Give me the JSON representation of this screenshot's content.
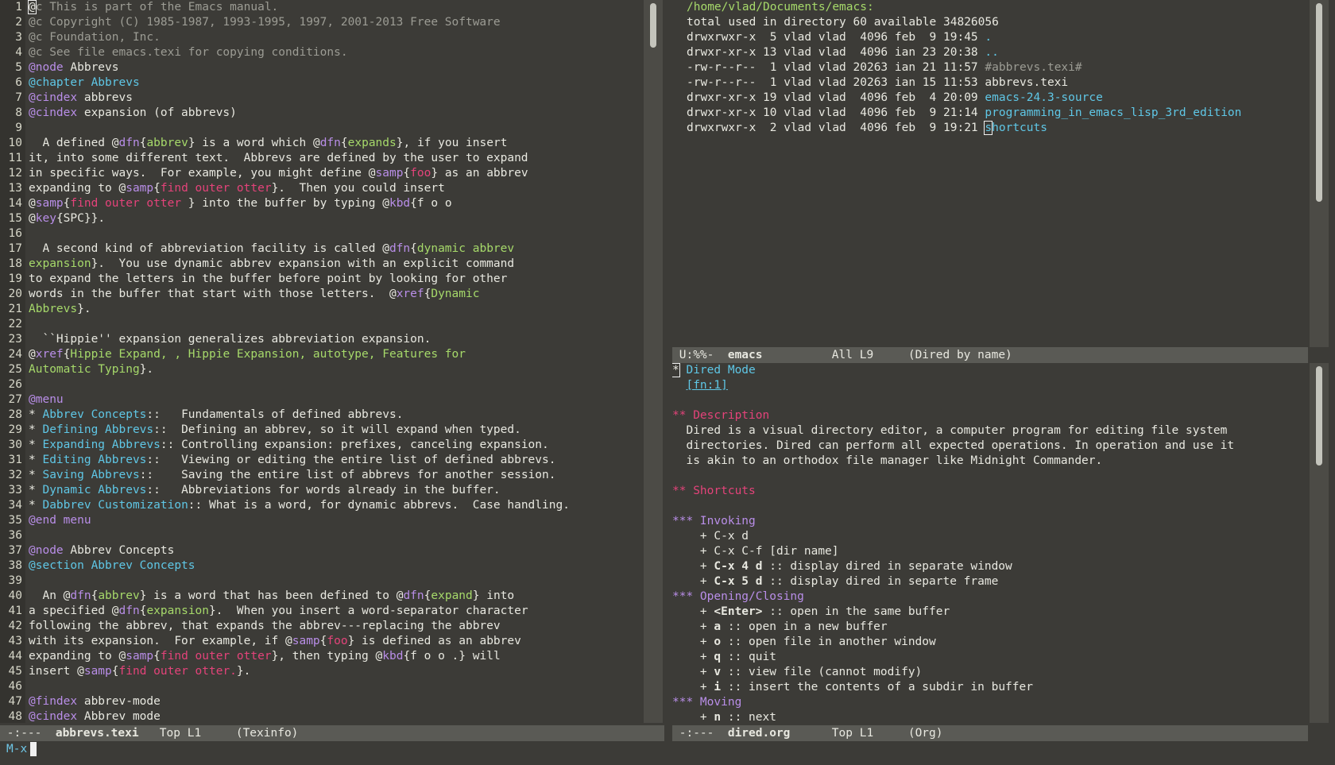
{
  "colors": {
    "background": "#3c3b37",
    "foreground": "#e8e8e0",
    "comment": "#9c9c94",
    "keyword": "#b98ee8",
    "reference": "#5fc7e6",
    "term": "#a6d96a",
    "sample": "#e4437a",
    "modeline": "#5a5a55"
  },
  "left_buffer": {
    "line_numbers": [
      "1",
      "2",
      "3",
      "4",
      "5",
      "6",
      "7",
      "8",
      "9",
      "10",
      "11",
      "12",
      "13",
      "14",
      "15",
      "16",
      "17",
      "18",
      "19",
      "20",
      "21",
      "22",
      "23",
      "24",
      "25",
      "26",
      "27",
      "28",
      "29",
      "30",
      "31",
      "32",
      "33",
      "34",
      "35",
      "36",
      "37",
      "38",
      "39",
      "40",
      "41",
      "42",
      "43",
      "44",
      "45",
      "46",
      "47",
      "48"
    ],
    "lines": [
      [
        {
          "t": "@",
          "s": "cursor"
        },
        {
          "t": "c This is part of the Emacs manual.",
          "s": "comment"
        }
      ],
      [
        {
          "t": "@c Copyright (C) 1985-1987, 1993-1995, 1997, 2001-2013 Free Software",
          "s": "comment"
        }
      ],
      [
        {
          "t": "@c Foundation, Inc.",
          "s": "comment"
        }
      ],
      [
        {
          "t": "@c See file emacs.texi for copying conditions.",
          "s": "comment"
        }
      ],
      [
        {
          "t": "@node",
          "s": "kw"
        },
        {
          "t": " Abbrevs",
          "s": ""
        }
      ],
      [
        {
          "t": "@chapter Abbrevs",
          "s": "cyan"
        }
      ],
      [
        {
          "t": "@cindex",
          "s": "kw"
        },
        {
          "t": " abbrevs",
          "s": ""
        }
      ],
      [
        {
          "t": "@cindex",
          "s": "kw"
        },
        {
          "t": " expansion (of abbrevs)",
          "s": ""
        }
      ],
      [],
      [
        {
          "t": "  A defined @",
          "s": ""
        },
        {
          "t": "dfn",
          "s": "kw"
        },
        {
          "t": "{",
          "s": ""
        },
        {
          "t": "abbrev",
          "s": "green"
        },
        {
          "t": "} is a word which @",
          "s": ""
        },
        {
          "t": "dfn",
          "s": "kw"
        },
        {
          "t": "{",
          "s": ""
        },
        {
          "t": "expands",
          "s": "green"
        },
        {
          "t": "}, if you insert",
          "s": ""
        }
      ],
      [
        {
          "t": "it, into some different text.  Abbrevs are defined by the user to expand",
          "s": ""
        }
      ],
      [
        {
          "t": "in specific ways.  For example, you might define @",
          "s": ""
        },
        {
          "t": "samp",
          "s": "kw"
        },
        {
          "t": "{",
          "s": ""
        },
        {
          "t": "foo",
          "s": "red"
        },
        {
          "t": "} as an abbrev",
          "s": ""
        }
      ],
      [
        {
          "t": "expanding to @",
          "s": ""
        },
        {
          "t": "samp",
          "s": "kw"
        },
        {
          "t": "{",
          "s": ""
        },
        {
          "t": "find outer otter",
          "s": "red"
        },
        {
          "t": "}.  Then you could insert",
          "s": ""
        }
      ],
      [
        {
          "t": "@",
          "s": ""
        },
        {
          "t": "samp",
          "s": "kw"
        },
        {
          "t": "{",
          "s": ""
        },
        {
          "t": "find outer otter ",
          "s": "red"
        },
        {
          "t": "} into the buffer by typing @",
          "s": ""
        },
        {
          "t": "kbd",
          "s": "kw"
        },
        {
          "t": "{f o o",
          "s": ""
        }
      ],
      [
        {
          "t": "@",
          "s": ""
        },
        {
          "t": "key",
          "s": "kw"
        },
        {
          "t": "{SPC}}.",
          "s": ""
        }
      ],
      [],
      [
        {
          "t": "  A second kind of abbreviation facility is called @",
          "s": ""
        },
        {
          "t": "dfn",
          "s": "kw"
        },
        {
          "t": "{",
          "s": ""
        },
        {
          "t": "dynamic abbrev",
          "s": "green"
        }
      ],
      [
        {
          "t": "expansion",
          "s": "green"
        },
        {
          "t": "}.  You use dynamic abbrev expansion with an explicit command",
          "s": ""
        }
      ],
      [
        {
          "t": "to expand the letters in the buffer before point by looking for other",
          "s": ""
        }
      ],
      [
        {
          "t": "words in the buffer that start with those letters.  @",
          "s": ""
        },
        {
          "t": "xref",
          "s": "kw"
        },
        {
          "t": "{",
          "s": ""
        },
        {
          "t": "Dynamic",
          "s": "green"
        }
      ],
      [
        {
          "t": "Abbrevs",
          "s": "green"
        },
        {
          "t": "}.",
          "s": ""
        }
      ],
      [],
      [
        {
          "t": "  ``Hippie'' expansion generalizes abbreviation expansion.",
          "s": ""
        }
      ],
      [
        {
          "t": "@",
          "s": ""
        },
        {
          "t": "xref",
          "s": "kw"
        },
        {
          "t": "{",
          "s": ""
        },
        {
          "t": "Hippie Expand, , Hippie Expansion, autotype, Features for",
          "s": "green"
        }
      ],
      [
        {
          "t": "Automatic Typing",
          "s": "green"
        },
        {
          "t": "}.",
          "s": ""
        }
      ],
      [],
      [
        {
          "t": "@menu",
          "s": "kw"
        }
      ],
      [
        {
          "t": "* ",
          "s": ""
        },
        {
          "t": "Abbrev Concepts",
          "s": "cyan"
        },
        {
          "t": "::   Fundamentals of defined abbrevs.",
          "s": ""
        }
      ],
      [
        {
          "t": "* ",
          "s": ""
        },
        {
          "t": "Defining Abbrevs",
          "s": "cyan"
        },
        {
          "t": "::  Defining an abbrev, so it will expand when typed.",
          "s": ""
        }
      ],
      [
        {
          "t": "* ",
          "s": ""
        },
        {
          "t": "Expanding Abbrevs",
          "s": "cyan"
        },
        {
          "t": ":: Controlling expansion: prefixes, canceling expansion.",
          "s": ""
        }
      ],
      [
        {
          "t": "* ",
          "s": ""
        },
        {
          "t": "Editing Abbrevs",
          "s": "cyan"
        },
        {
          "t": "::   Viewing or editing the entire list of defined abbrevs.",
          "s": ""
        }
      ],
      [
        {
          "t": "* ",
          "s": ""
        },
        {
          "t": "Saving Abbrevs",
          "s": "cyan"
        },
        {
          "t": "::    Saving the entire list of abbrevs for another session.",
          "s": ""
        }
      ],
      [
        {
          "t": "* ",
          "s": ""
        },
        {
          "t": "Dynamic Abbrevs",
          "s": "cyan"
        },
        {
          "t": "::   Abbreviations for words already in the buffer.",
          "s": ""
        }
      ],
      [
        {
          "t": "* ",
          "s": ""
        },
        {
          "t": "Dabbrev Customization",
          "s": "cyan"
        },
        {
          "t": ":: What is a word, for dynamic abbrevs.  Case handling.",
          "s": ""
        }
      ],
      [
        {
          "t": "@end menu",
          "s": "kw"
        }
      ],
      [],
      [
        {
          "t": "@node",
          "s": "kw"
        },
        {
          "t": " Abbrev Concepts",
          "s": ""
        }
      ],
      [
        {
          "t": "@section Abbrev Concepts",
          "s": "cyan"
        }
      ],
      [],
      [
        {
          "t": "  An @",
          "s": ""
        },
        {
          "t": "dfn",
          "s": "kw"
        },
        {
          "t": "{",
          "s": ""
        },
        {
          "t": "abbrev",
          "s": "green"
        },
        {
          "t": "} is a word that has been defined to @",
          "s": ""
        },
        {
          "t": "dfn",
          "s": "kw"
        },
        {
          "t": "{",
          "s": ""
        },
        {
          "t": "expand",
          "s": "green"
        },
        {
          "t": "} into",
          "s": ""
        }
      ],
      [
        {
          "t": "a specified @",
          "s": ""
        },
        {
          "t": "dfn",
          "s": "kw"
        },
        {
          "t": "{",
          "s": ""
        },
        {
          "t": "expansion",
          "s": "green"
        },
        {
          "t": "}.  When you insert a word-separator character",
          "s": ""
        }
      ],
      [
        {
          "t": "following the abbrev, that expands the abbrev---replacing the abbrev",
          "s": ""
        }
      ],
      [
        {
          "t": "with its expansion.  For example, if @",
          "s": ""
        },
        {
          "t": "samp",
          "s": "kw"
        },
        {
          "t": "{",
          "s": ""
        },
        {
          "t": "foo",
          "s": "red"
        },
        {
          "t": "} is defined as an abbrev",
          "s": ""
        }
      ],
      [
        {
          "t": "expanding to @",
          "s": ""
        },
        {
          "t": "samp",
          "s": "kw"
        },
        {
          "t": "{",
          "s": ""
        },
        {
          "t": "find outer otter",
          "s": "red"
        },
        {
          "t": "}, then typing @",
          "s": ""
        },
        {
          "t": "kbd",
          "s": "kw"
        },
        {
          "t": "{f o o .} will",
          "s": ""
        }
      ],
      [
        {
          "t": "insert @",
          "s": ""
        },
        {
          "t": "samp",
          "s": "kw"
        },
        {
          "t": "{",
          "s": ""
        },
        {
          "t": "find outer otter.",
          "s": "red"
        },
        {
          "t": "}.",
          "s": ""
        }
      ],
      [],
      [
        {
          "t": "@findex",
          "s": "kw"
        },
        {
          "t": " abbrev-mode",
          "s": ""
        }
      ],
      [
        {
          "t": "@cindex",
          "s": "kw"
        },
        {
          "t": " Abbrev mode",
          "s": ""
        }
      ]
    ]
  },
  "right_top_buffer": {
    "lines": [
      [
        {
          "t": "/home/vlad/Documents/emacs:",
          "s": "green"
        }
      ],
      [
        {
          "t": "total used in directory 60 available 34826056",
          "s": ""
        }
      ],
      [
        {
          "t": "drwxrwxr-x  5 vlad vlad  4096 feb  9 19:45 ",
          "s": ""
        },
        {
          "t": ".",
          "s": "dir"
        }
      ],
      [
        {
          "t": "drwxr-xr-x 13 vlad vlad  4096 ian 23 20:38 ",
          "s": ""
        },
        {
          "t": "..",
          "s": "dir"
        }
      ],
      [
        {
          "t": "-rw-r--r--  1 vlad vlad 20263 ian 21 11:57 ",
          "s": ""
        },
        {
          "t": "#abbrevs.texi#",
          "s": "comment"
        }
      ],
      [
        {
          "t": "-rw-r--r--  1 vlad vlad 20263 ian 15 11:53 abbrevs.texi",
          "s": ""
        }
      ],
      [
        {
          "t": "drwxr-xr-x 19 vlad vlad  4096 feb  4 20:09 ",
          "s": ""
        },
        {
          "t": "emacs-24.3-source",
          "s": "dir"
        }
      ],
      [
        {
          "t": "drwxr-xr-x 10 vlad vlad  4096 feb  9 21:14 ",
          "s": ""
        },
        {
          "t": "programming_in_emacs_lisp_3rd_edition",
          "s": "dir"
        }
      ],
      [
        {
          "t": "drwxrwxr-x  2 vlad vlad  4096 feb  9 19:21 ",
          "s": ""
        },
        {
          "t": "s",
          "s": "dircursor"
        },
        {
          "t": "hortcuts",
          "s": "dir"
        }
      ]
    ]
  },
  "right_bottom_buffer": {
    "lines": [
      [
        {
          "t": "*",
          "s": "cursor"
        },
        {
          "t": " Dired Mode",
          "s": "cyan"
        }
      ],
      [
        {
          "t": "  ",
          "s": ""
        },
        {
          "t": "[fn:1]",
          "s": "link"
        }
      ],
      [],
      [
        {
          "t": "** Description",
          "s": "h2"
        }
      ],
      [
        {
          "t": "  Dired is a visual directory editor, a computer program for editing file system",
          "s": ""
        }
      ],
      [
        {
          "t": "  directories. Dired can perform all expected operations. In operation and use it",
          "s": ""
        }
      ],
      [
        {
          "t": "  is akin to an orthodox file manager like Midnight Commander.",
          "s": ""
        }
      ],
      [],
      [
        {
          "t": "** Shortcuts",
          "s": "h2"
        }
      ],
      [],
      [
        {
          "t": "*** Invoking",
          "s": "h3"
        }
      ],
      [
        {
          "t": "    + C-x d",
          "s": ""
        }
      ],
      [
        {
          "t": "    + C-x C-f [dir name]",
          "s": ""
        }
      ],
      [
        {
          "t": "    + ",
          "s": ""
        },
        {
          "t": "C-x 4 d",
          "s": "bold"
        },
        {
          "t": " :: display dired in separate window",
          "s": ""
        }
      ],
      [
        {
          "t": "    + ",
          "s": ""
        },
        {
          "t": "C-x 5 d",
          "s": "bold"
        },
        {
          "t": " :: display dired in separte frame",
          "s": ""
        }
      ],
      [
        {
          "t": "*** Opening/Closing",
          "s": "h3"
        }
      ],
      [
        {
          "t": "    + ",
          "s": ""
        },
        {
          "t": "<Enter>",
          "s": "bold"
        },
        {
          "t": " :: open in the same buffer",
          "s": ""
        }
      ],
      [
        {
          "t": "    + ",
          "s": ""
        },
        {
          "t": "a",
          "s": "bold"
        },
        {
          "t": " :: open in a new buffer",
          "s": ""
        }
      ],
      [
        {
          "t": "    + ",
          "s": ""
        },
        {
          "t": "o",
          "s": "bold"
        },
        {
          "t": " :: open file in another window",
          "s": ""
        }
      ],
      [
        {
          "t": "    + ",
          "s": ""
        },
        {
          "t": "q",
          "s": "bold"
        },
        {
          "t": " :: quit",
          "s": ""
        }
      ],
      [
        {
          "t": "    + ",
          "s": ""
        },
        {
          "t": "v",
          "s": "bold"
        },
        {
          "t": " :: view file (cannot modify)",
          "s": ""
        }
      ],
      [
        {
          "t": "    + ",
          "s": ""
        },
        {
          "t": "i",
          "s": "bold"
        },
        {
          "t": " :: insert the contents of a subdir in buffer",
          "s": ""
        }
      ],
      [
        {
          "t": "*** Moving",
          "s": "h3"
        }
      ],
      [
        {
          "t": "    + ",
          "s": ""
        },
        {
          "t": "n",
          "s": "bold"
        },
        {
          "t": " :: next",
          "s": ""
        }
      ]
    ]
  },
  "modelines": {
    "left": {
      "status": " -:---  ",
      "buffer": "abbrevs.texi",
      "position": "   Top L1",
      "mode": "     (Texinfo)"
    },
    "right_top": {
      "status": " U:%%-  ",
      "buffer": "emacs",
      "position": "          All L9",
      "mode": "     (Dired by name)"
    },
    "right_bottom": {
      "status": " -:---  ",
      "buffer": "dired.org",
      "position": "      Top L1",
      "mode": "     (Org)"
    }
  },
  "minibuffer": {
    "prompt": "M-x"
  }
}
